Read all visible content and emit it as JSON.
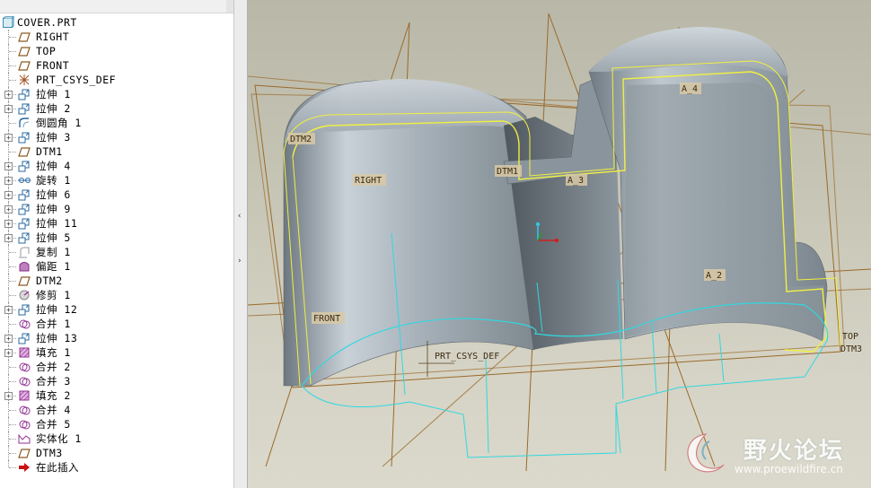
{
  "tree": {
    "root": "COVER.PRT",
    "items": [
      {
        "label": "RIGHT",
        "icon": "datum-plane-icon",
        "expandable": false
      },
      {
        "label": "TOP",
        "icon": "datum-plane-icon",
        "expandable": false
      },
      {
        "label": "FRONT",
        "icon": "datum-plane-icon",
        "expandable": false
      },
      {
        "label": "PRT_CSYS_DEF",
        "icon": "coordinate-system-icon",
        "expandable": false
      },
      {
        "label": "拉伸 1",
        "icon": "extrude-icon",
        "expandable": true
      },
      {
        "label": "拉伸 2",
        "icon": "extrude-icon",
        "expandable": true
      },
      {
        "label": "倒圆角 1",
        "icon": "round-icon",
        "expandable": false
      },
      {
        "label": "拉伸 3",
        "icon": "extrude-icon",
        "expandable": true
      },
      {
        "label": "DTM1",
        "icon": "datum-plane-icon",
        "expandable": false
      },
      {
        "label": "拉伸 4",
        "icon": "extrude-icon",
        "expandable": true
      },
      {
        "label": "旋转 1",
        "icon": "revolve-icon",
        "expandable": true
      },
      {
        "label": "拉伸 6",
        "icon": "extrude-icon",
        "expandable": true
      },
      {
        "label": "拉伸 9",
        "icon": "extrude-icon",
        "expandable": true
      },
      {
        "label": "拉伸 11",
        "icon": "extrude-icon",
        "expandable": true
      },
      {
        "label": "拉伸 5",
        "icon": "extrude-icon",
        "expandable": true
      },
      {
        "label": "复制 1",
        "icon": "copy-icon",
        "expandable": false
      },
      {
        "label": "偏距 1",
        "icon": "offset-icon",
        "expandable": false
      },
      {
        "label": "DTM2",
        "icon": "datum-plane-icon",
        "expandable": false
      },
      {
        "label": "修剪 1",
        "icon": "trim-icon",
        "expandable": false
      },
      {
        "label": "拉伸 12",
        "icon": "extrude-icon",
        "expandable": true
      },
      {
        "label": "合并 1",
        "icon": "merge-icon",
        "expandable": false
      },
      {
        "label": "拉伸 13",
        "icon": "extrude-icon",
        "expandable": true
      },
      {
        "label": "填充 1",
        "icon": "fill-icon",
        "expandable": true
      },
      {
        "label": "合并 2",
        "icon": "merge-icon",
        "expandable": false
      },
      {
        "label": "合并 3",
        "icon": "merge-icon",
        "expandable": false
      },
      {
        "label": "填充 2",
        "icon": "fill-icon",
        "expandable": true
      },
      {
        "label": "合并 4",
        "icon": "merge-icon",
        "expandable": false
      },
      {
        "label": "合并 5",
        "icon": "merge-icon",
        "expandable": false
      },
      {
        "label": "实体化 1",
        "icon": "solidify-icon",
        "expandable": false
      },
      {
        "label": "DTM3",
        "icon": "datum-plane-icon",
        "expandable": false
      },
      {
        "label": "在此插入",
        "icon": "insert-here-arrow-icon",
        "expandable": false
      }
    ]
  },
  "splitter": {
    "collapse": "‹",
    "expand": "›"
  },
  "viewport": {
    "labels": {
      "dtm2": "DTM2",
      "right": "RIGHT",
      "dtm1": "DTM1",
      "a3": "A_3",
      "a4": "A_4",
      "a2": "A_2",
      "front": "FRONT",
      "csys": "PRT_CSYS_DEF",
      "top": "TOP",
      "dtm3": "DTM3"
    },
    "colors": {
      "datum": "#9a6a2a",
      "edge_highlight": "#f0f040",
      "sketch": "#30d8e0",
      "surface": "#9aa4ac"
    }
  },
  "watermark": {
    "name": "野火论坛",
    "url": "www.proewildfire.cn"
  }
}
